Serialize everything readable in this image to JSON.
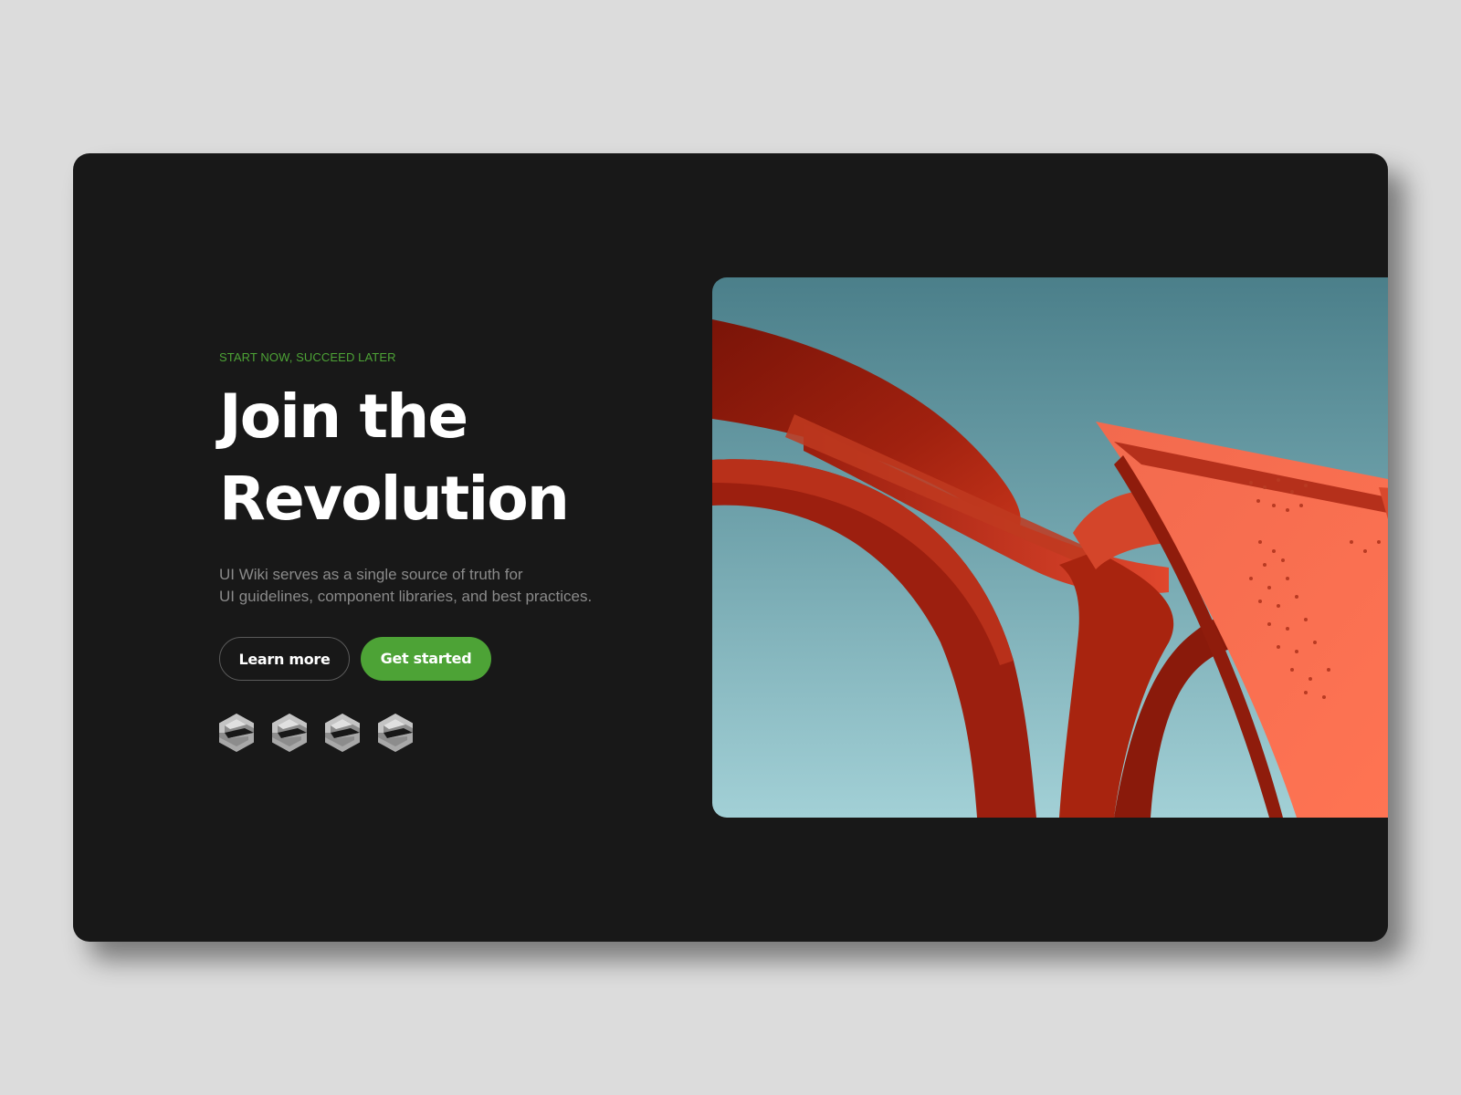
{
  "hero": {
    "eyebrow": "START NOW, SUCCEED LATER",
    "headline_line1": "Join the",
    "headline_line2": "Revolution",
    "description_line1": "UI Wiki serves as a single source of truth for",
    "description_line2": "UI guidelines, component libraries, and best practices."
  },
  "buttons": {
    "learn_more": "Learn more",
    "get_started": "Get started"
  },
  "logos": [
    {
      "icon": "hexagon-s-logo-icon"
    },
    {
      "icon": "hexagon-s-logo-icon"
    },
    {
      "icon": "hexagon-s-logo-icon"
    },
    {
      "icon": "hexagon-s-logo-icon"
    }
  ],
  "image": {
    "subject": "red-sculpture-against-sky"
  },
  "colors": {
    "page_background": "#dcdcdc",
    "card_background": "#181818",
    "accent_green": "#4da336",
    "headline": "#ffffff",
    "description": "#8a8a8a",
    "sky_top": "#4b7f8a",
    "sky_bottom": "#a2d0d6",
    "sculpture_dark_red": "#8e1a0c",
    "sculpture_orange": "#f4644a"
  }
}
